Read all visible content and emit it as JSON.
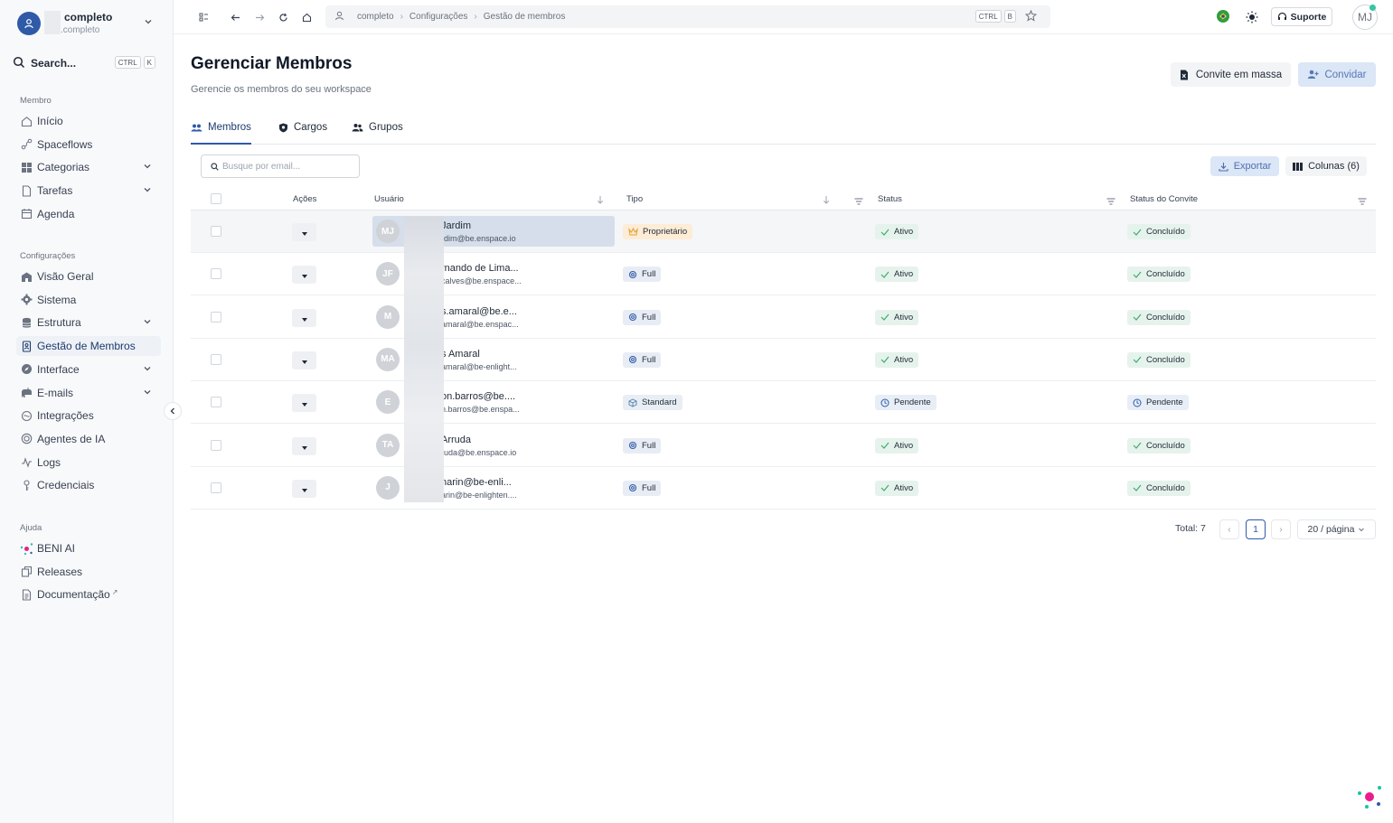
{
  "workspace": {
    "name": "completo",
    "sub": ".completo"
  },
  "search": {
    "label": "Search...",
    "kbd1": "CTRL",
    "kbd2": "K"
  },
  "sidebar": {
    "sections": [
      {
        "title": "Membro",
        "items": [
          {
            "label": "Início",
            "icon": "home-icon",
            "chevron": false
          },
          {
            "label": "Spaceflows",
            "icon": "flow-icon",
            "chevron": false
          },
          {
            "label": "Categorias",
            "icon": "grid-icon",
            "chevron": true
          },
          {
            "label": "Tarefas",
            "icon": "file-icon",
            "chevron": true
          },
          {
            "label": "Agenda",
            "icon": "calendar-icon",
            "chevron": false
          }
        ]
      },
      {
        "title": "Configurações",
        "items": [
          {
            "label": "Visão Geral",
            "icon": "building-icon",
            "chevron": false
          },
          {
            "label": "Sistema",
            "icon": "gear-icon",
            "chevron": false
          },
          {
            "label": "Estrutura",
            "icon": "database-icon",
            "chevron": true
          },
          {
            "label": "Gestão de Membros",
            "icon": "badge-icon",
            "chevron": false,
            "active": true
          },
          {
            "label": "Interface",
            "icon": "compass-icon",
            "chevron": true
          },
          {
            "label": "E-mails",
            "icon": "mailbox-icon",
            "chevron": true
          },
          {
            "label": "Integrações",
            "icon": "link-icon",
            "chevron": false
          },
          {
            "label": "Agentes de IA",
            "icon": "bot-icon",
            "chevron": false
          },
          {
            "label": "Logs",
            "icon": "pulse-icon",
            "chevron": false
          },
          {
            "label": "Credenciais",
            "icon": "key-icon",
            "chevron": false
          }
        ]
      },
      {
        "title": "Ajuda",
        "items": [
          {
            "label": "BENI AI",
            "icon": "beni-icon",
            "chevron": false
          },
          {
            "label": "Releases",
            "icon": "copy-icon",
            "chevron": false
          },
          {
            "label": "Documentação",
            "icon": "doc-icon",
            "chevron": false,
            "external": "↗"
          }
        ]
      }
    ]
  },
  "topbar": {
    "breadcrumbs": [
      "completo",
      "Configurações",
      "Gestão de membros"
    ],
    "kbd1": "CTRL",
    "kbd2": "B",
    "support_label": "Suporte",
    "user_initials": "MJ"
  },
  "page": {
    "title": "Gerenciar Membros",
    "subtitle": "Gerencie os membros do seu workspace",
    "bulk_invite_label": "Convite em massa",
    "invite_label": "Convidar"
  },
  "tabs": [
    {
      "label": "Membros",
      "icon": "users-icon",
      "active": true
    },
    {
      "label": "Cargos",
      "icon": "shield-icon",
      "active": false
    },
    {
      "label": "Grupos",
      "icon": "group-icon",
      "active": false
    }
  ],
  "toolbar": {
    "search_placeholder": "Busque por email...",
    "export_label": "Exportar",
    "columns_label": "Colunas (6)"
  },
  "table": {
    "headers": {
      "actions": "Ações",
      "user": "Usuário",
      "type": "Tipo",
      "status": "Status",
      "invite_status": "Status do Convite"
    },
    "rows": [
      {
        "initials": "MJ",
        "name": "Jardim",
        "email": "rdim@be.enspace.io",
        "type": "Proprietário",
        "type_kind": "owner",
        "status": "Ativo",
        "status_kind": "ok",
        "invite": "Concluído",
        "invite_kind": "ok",
        "highlight": true
      },
      {
        "initials": "JF",
        "name": "rnando de Lima...",
        "email": "calves@be.enspace...",
        "type": "Full",
        "type_kind": "full",
        "status": "Ativo",
        "status_kind": "ok",
        "invite": "Concluído",
        "invite_kind": "ok"
      },
      {
        "initials": "M",
        "name": "s.amaral@be.e...",
        "email": "amaral@be.enspac...",
        "type": "Full",
        "type_kind": "full",
        "status": "Ativo",
        "status_kind": "ok",
        "invite": "Concluído",
        "invite_kind": "ok"
      },
      {
        "initials": "MA",
        "name": "s Amaral",
        "email": "amaral@be-enlight...",
        "type": "Full",
        "type_kind": "full",
        "status": "Ativo",
        "status_kind": "ok",
        "invite": "Concluído",
        "invite_kind": "ok"
      },
      {
        "initials": "E",
        "name": "on.barros@be....",
        "email": "n.barros@be.enspa...",
        "type": "Standard",
        "type_kind": "std",
        "status": "Pendente",
        "status_kind": "pend",
        "invite": "Pendente",
        "invite_kind": "pend"
      },
      {
        "initials": "TA",
        "name": "Arruda",
        "email": "ruda@be.enspace.io",
        "type": "Full",
        "type_kind": "full",
        "status": "Ativo",
        "status_kind": "ok",
        "invite": "Concluído",
        "invite_kind": "ok"
      },
      {
        "initials": "J",
        "name": "narin@be-enli...",
        "email": "arin@be-enlighten....",
        "type": "Full",
        "type_kind": "full",
        "status": "Ativo",
        "status_kind": "ok",
        "invite": "Concluído",
        "invite_kind": "ok"
      }
    ]
  },
  "pagination": {
    "total": "Total: 7",
    "current_page": "1",
    "prev": "‹",
    "next": "›",
    "page_size": "20 / página"
  },
  "colors": {
    "accent": "#2f5aa8",
    "success": "#3aa86b",
    "owner": "#e8a23b"
  }
}
